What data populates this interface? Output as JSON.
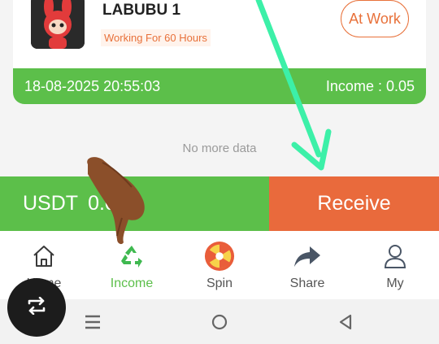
{
  "order_card": {
    "product_name": "LABUBU 1",
    "status_tag": "Working For 60 Hours",
    "status_button": "At Work",
    "timestamp": "18-08-2025 20:55:03",
    "income": "Income : 0.05"
  },
  "list": {
    "end_text": "No more data"
  },
  "action_bar": {
    "balance_label": "USDT",
    "balance_value": "0.02",
    "receive_label": "Receive"
  },
  "bottom_nav": {
    "items": [
      {
        "label": "Home",
        "icon": "home-icon"
      },
      {
        "label": "Income",
        "icon": "recycle-icon"
      },
      {
        "label": "Spin",
        "icon": "spin-wheel-icon"
      },
      {
        "label": "Share",
        "icon": "share-arrow-icon"
      },
      {
        "label": "My",
        "icon": "user-icon"
      }
    ],
    "active": "Income"
  },
  "colors": {
    "green": "#5cbf4a",
    "orange": "#e96a3c",
    "annotation_arrow": "#3cf0a8"
  }
}
